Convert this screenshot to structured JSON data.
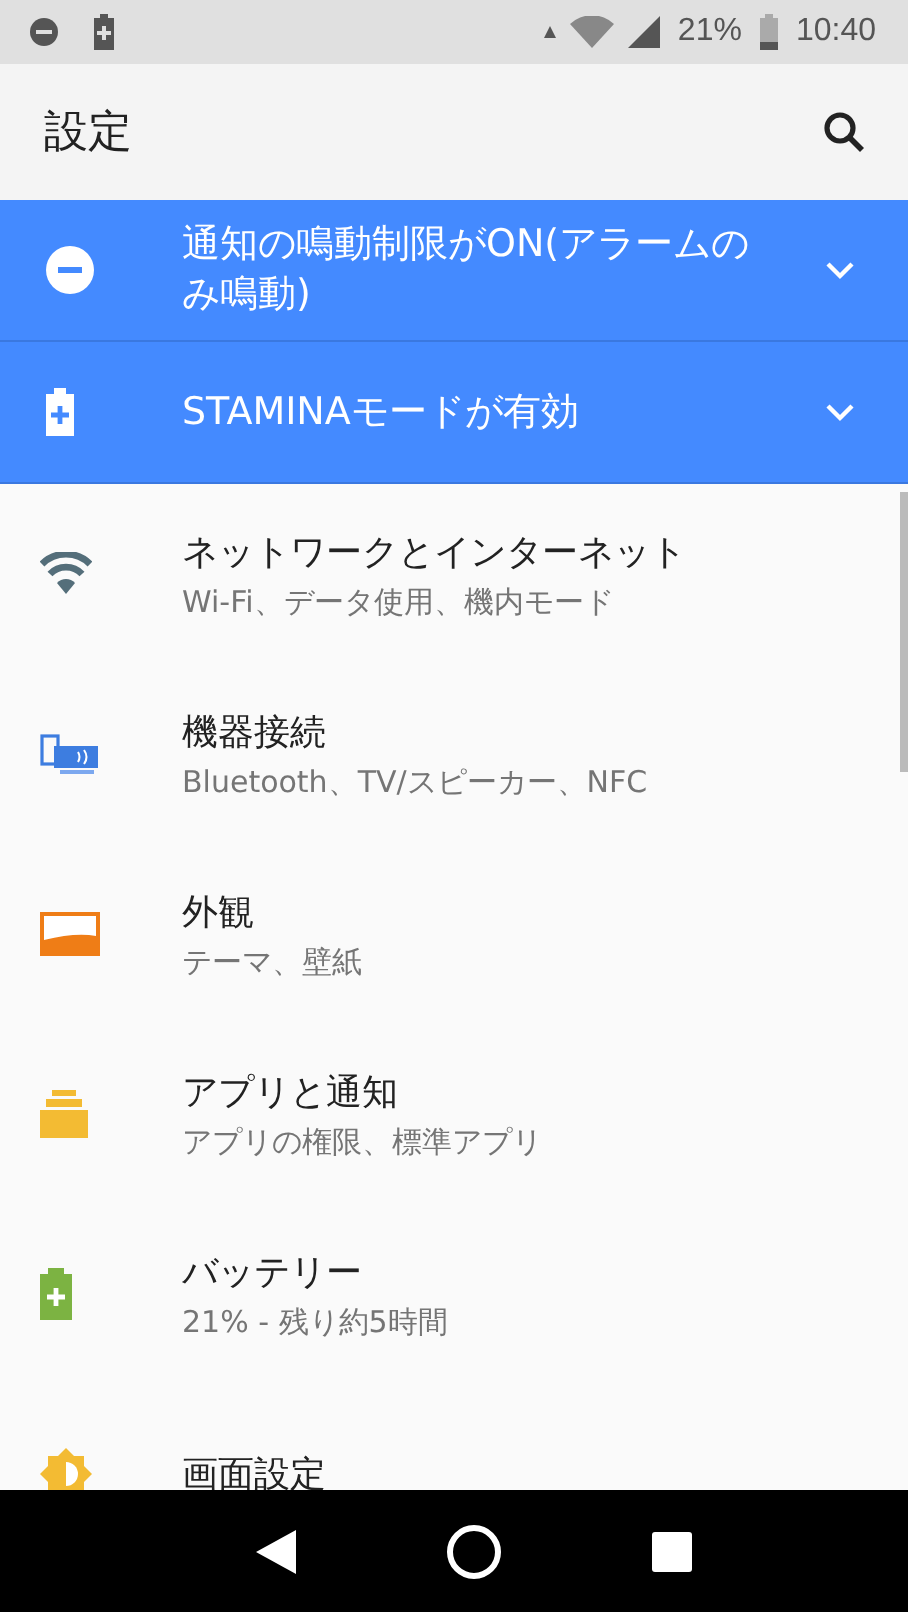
{
  "status_bar": {
    "battery_percent": "21%",
    "time": "10:40"
  },
  "app_bar": {
    "title": "設定"
  },
  "conditions": [
    {
      "kind": "dnd",
      "title": "通知の鳴動制限がON(アラームのみ鳴動)",
      "expanded": false
    },
    {
      "kind": "battery",
      "title": "STAMINAモードが有効",
      "expanded": false
    }
  ],
  "items": [
    {
      "kind": "wifi",
      "title": "ネットワークとインターネット",
      "subtitle": "Wi-Fi、データ使用、機内モード"
    },
    {
      "kind": "devices",
      "title": "機器接続",
      "subtitle": "Bluetooth、TV/スピーカー、NFC"
    },
    {
      "kind": "appearance",
      "title": "外観",
      "subtitle": "テーマ、壁紙"
    },
    {
      "kind": "apps",
      "title": "アプリと通知",
      "subtitle": "アプリの権限、標準アプリ"
    },
    {
      "kind": "battery",
      "title": "バッテリー",
      "subtitle": "21% - 残り約5時間"
    },
    {
      "kind": "display",
      "title": "画面設定"
    }
  ]
}
